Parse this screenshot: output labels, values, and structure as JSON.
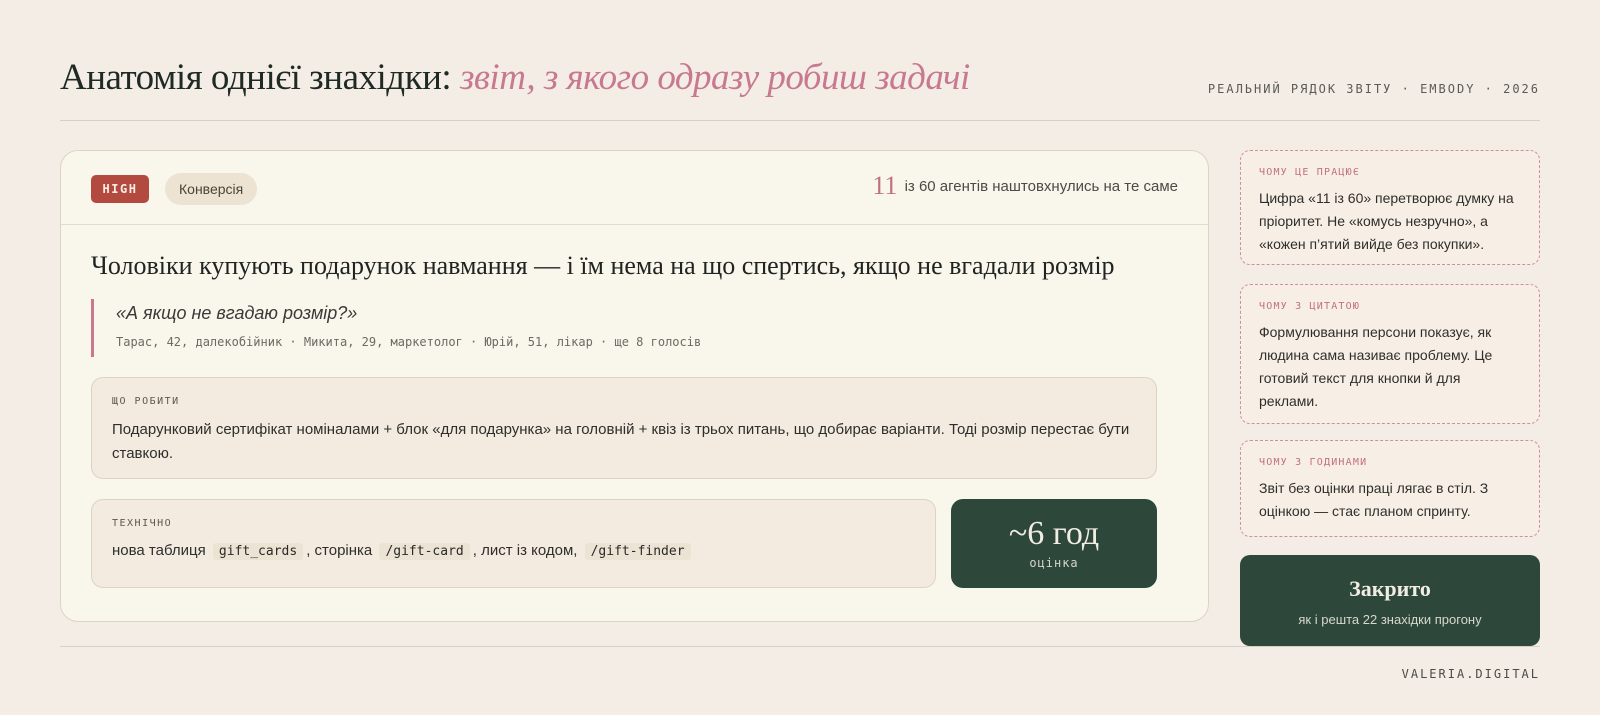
{
  "header": {
    "title_main": "Анатомія однієї знахідки: ",
    "title_accent": "звіт, з якого одразу робиш задачі",
    "meta": "РЕАЛЬНИЙ РЯДОК ЗВІТУ · EMBODY · 2026"
  },
  "finding": {
    "priority": "HIGH",
    "category": "Конверсія",
    "agents_count": "11",
    "agents_text": "із 60 агентів наштовхнулись на те саме",
    "heading": "Чоловіки купують подарунок навмання — і їм нема на що спертись, якщо не вгадали розмір",
    "quote": "«А якщо не вгадаю розмір?»",
    "quote_authors": "Тарас, 42, далекобійник · Микита, 29, маркетолог · Юрій, 51, лікар · ще 8 голосів",
    "todo_label": "ЩО РОБИТИ",
    "todo_text": "Подарунковий сертифікат номіналами + блок «для подарунка» на головній + квіз із трьох питань, що добирає варіанти. Тоді розмір перестає бути ставкою.",
    "tech_label": "ТЕХНІЧНО",
    "tech_prefix": "нова таблиця",
    "tech_code1": "gift_cards",
    "tech_mid1": ", сторінка",
    "tech_code2": "/gift-card",
    "tech_mid2": ", лист із кодом,",
    "tech_code3": "/gift-finder",
    "estimate_value": "~6 год",
    "estimate_label": "оцінка"
  },
  "notes": [
    {
      "label": "ЧОМУ ЦЕ ПРАЦЮЄ",
      "text": "Цифра «11 із 60» перетворює думку на пріоритет. Не «комусь незручно», а «кожен п’ятий вийде без покупки»."
    },
    {
      "label": "ЧОМУ З ЦИТАТОЮ",
      "text": "Формулювання персони показує, як людина сама називає проблему. Це готовий текст для кнопки й для реклами."
    },
    {
      "label": "ЧОМУ З ГОДИНАМИ",
      "text": "Звіт без оцінки праці лягає в стіл. З оцінкою — стає планом спринту."
    }
  ],
  "closed": {
    "title": "Закрито",
    "subtitle": "як і решта 22 знахідки прогону"
  },
  "footer": "VALERIA.DIGITAL",
  "colors": {
    "background": "#f4ede5",
    "accent_pink": "#c8798f",
    "high_red": "#b34a40",
    "dark_green": "#2d473b"
  }
}
